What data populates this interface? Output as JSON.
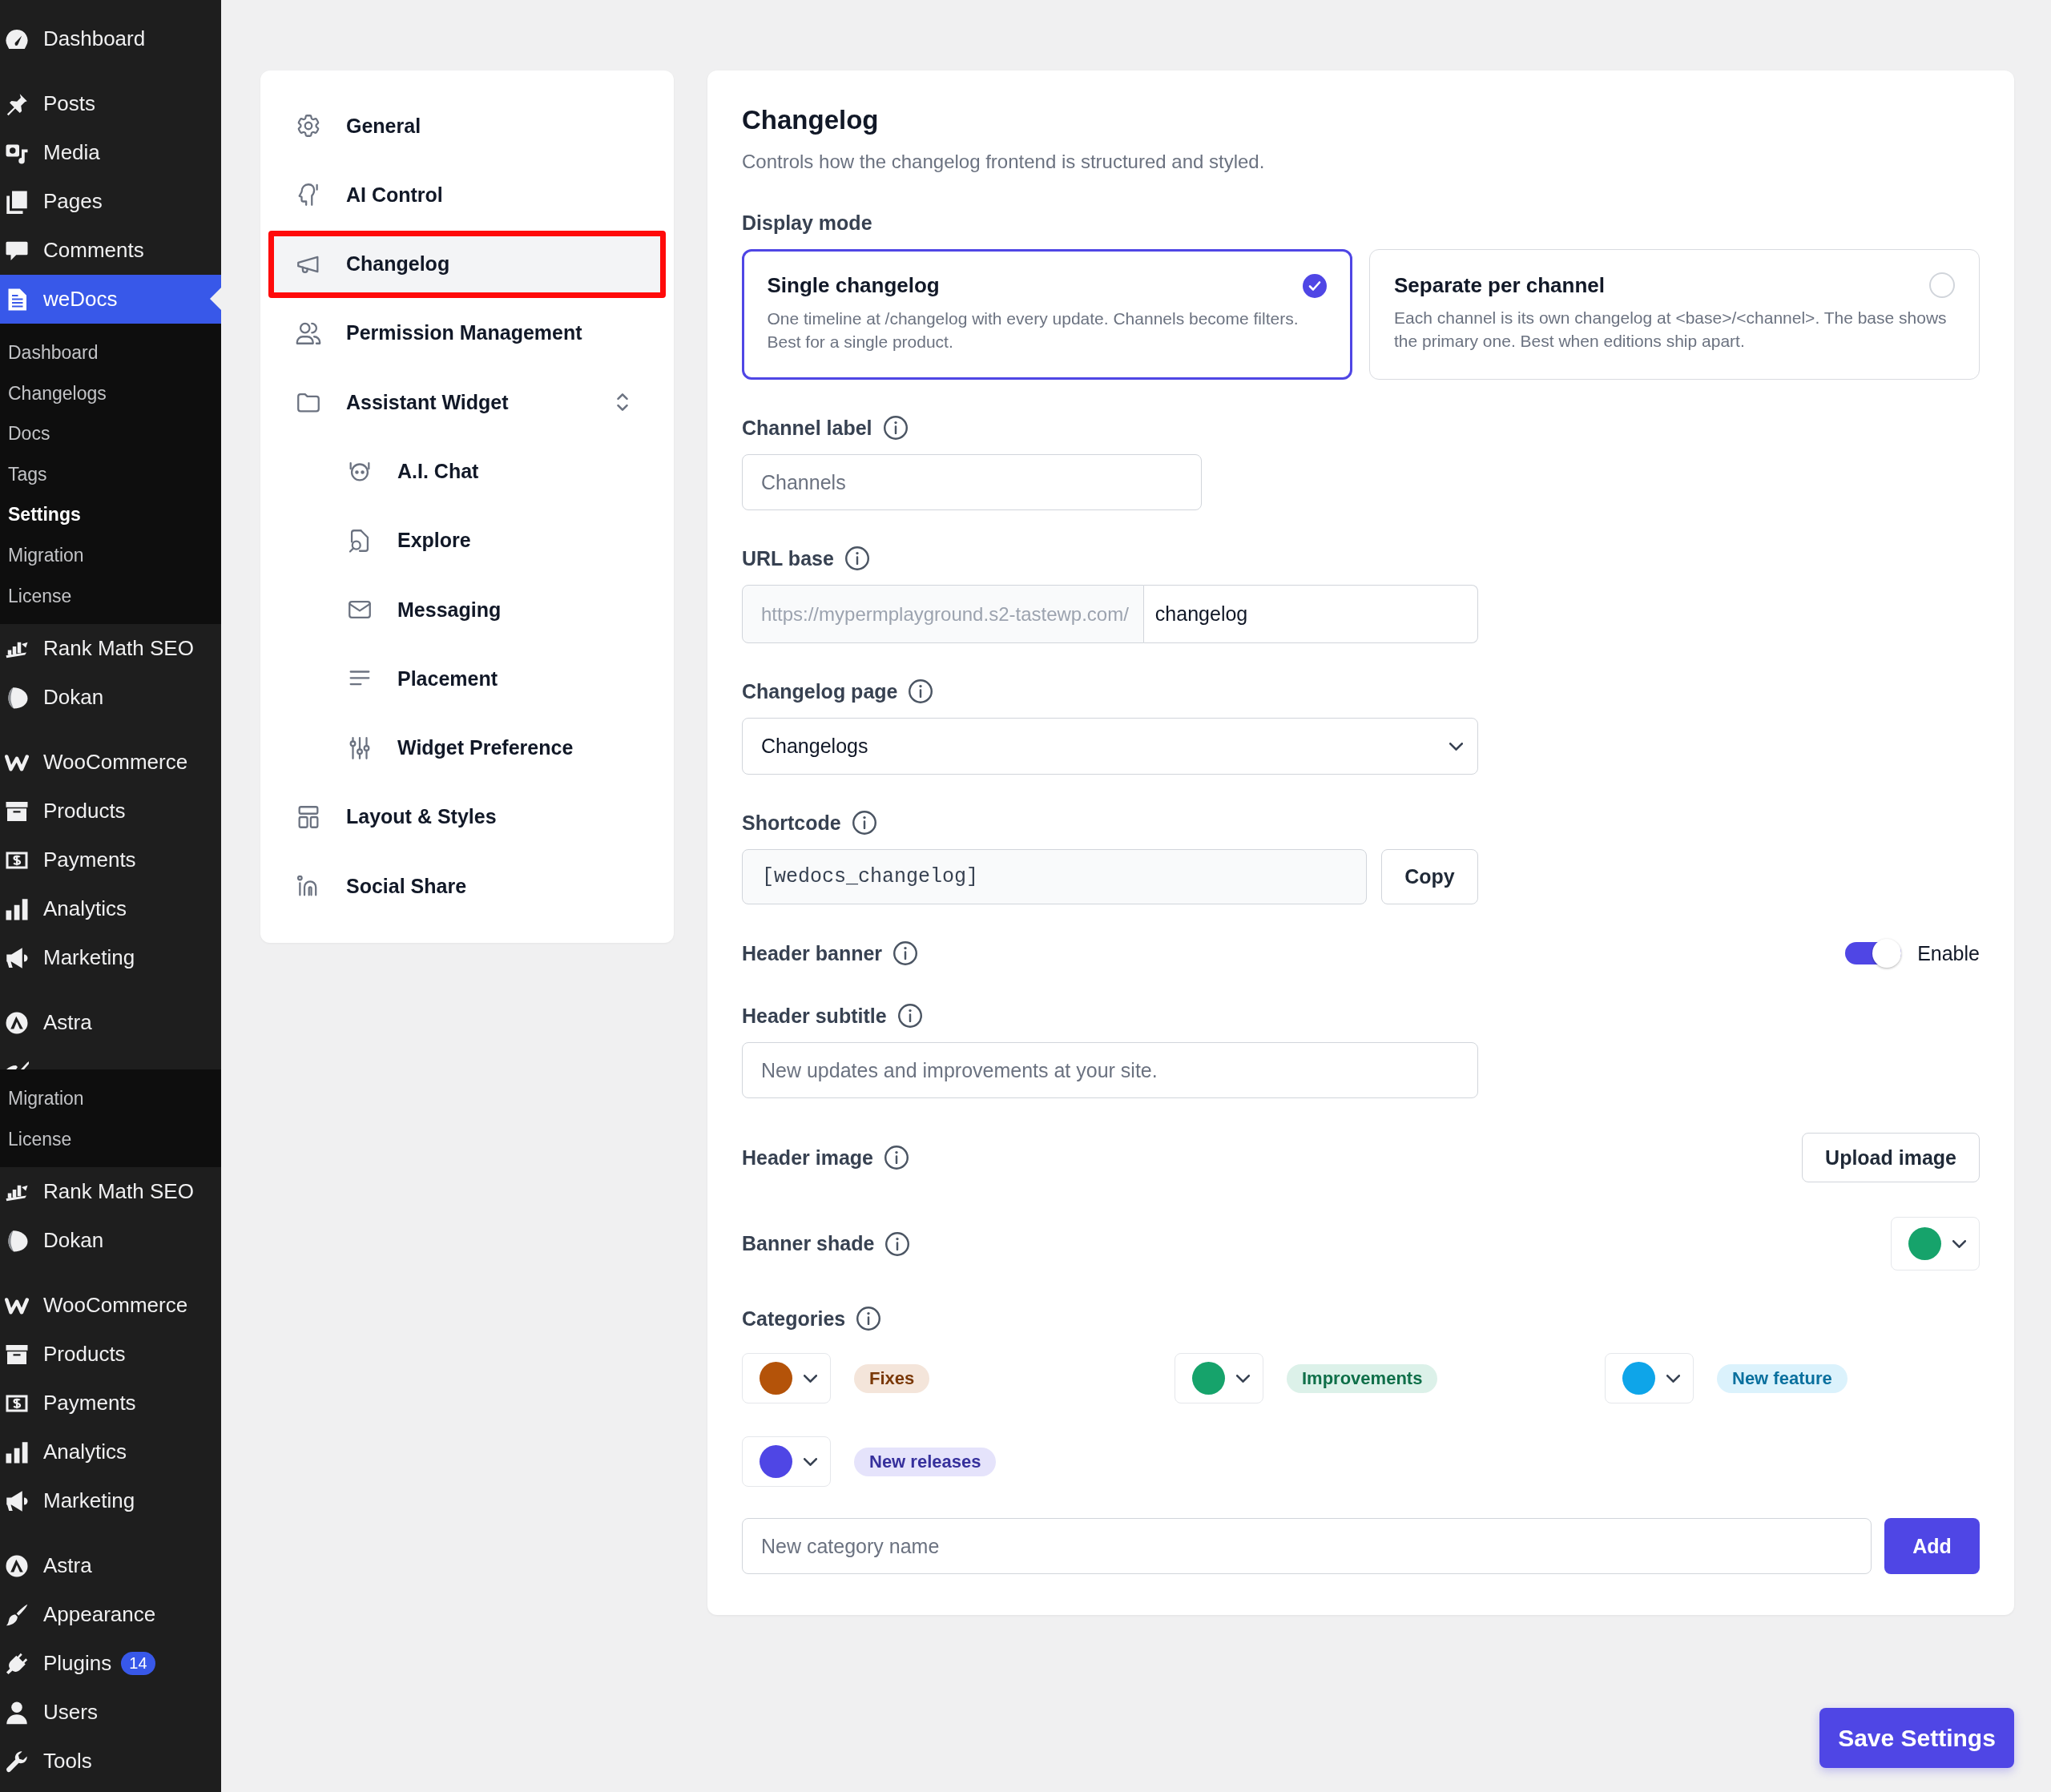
{
  "admin_menu": [
    {
      "kind": "group",
      "items": [
        {
          "label": "Dashboard",
          "selected": false
        }
      ]
    },
    {
      "kind": "group",
      "items": [
        {
          "label": "Posts",
          "selected": false
        },
        {
          "label": "Media",
          "selected": false
        },
        {
          "label": "Pages",
          "selected": false
        },
        {
          "label": "Comments",
          "selected": false
        },
        {
          "label": "weDocs",
          "selected": true,
          "submenu": [
            {
              "label": "Dashboard",
              "selected": false
            },
            {
              "label": "Changelogs",
              "selected": false
            },
            {
              "label": "Docs",
              "selected": false
            },
            {
              "label": "Tags",
              "selected": false
            },
            {
              "label": "Settings",
              "selected": true
            },
            {
              "label": "Migration",
              "selected": false
            },
            {
              "label": "License",
              "selected": false
            }
          ]
        }
      ]
    },
    {
      "kind": "group",
      "items": [
        {
          "label": "Rank Math SEO",
          "selected": false
        },
        {
          "label": "Dokan",
          "selected": false
        }
      ]
    },
    {
      "kind": "group",
      "items": [
        {
          "label": "WooCommerce",
          "selected": false
        },
        {
          "label": "Products",
          "selected": false
        },
        {
          "label": "Payments",
          "selected": false
        },
        {
          "label": "Analytics",
          "selected": false
        },
        {
          "label": "Marketing",
          "selected": false
        }
      ]
    },
    {
      "kind": "group",
      "items": [
        {
          "label": "Astra",
          "selected": false
        },
        {
          "kind": "clipped"
        }
      ]
    },
    {
      "kind": "submenu",
      "items": [
        {
          "label": "Migration",
          "selected": false
        },
        {
          "label": "License",
          "selected": false
        }
      ]
    },
    {
      "kind": "group",
      "items": [
        {
          "label": "Rank Math SEO",
          "selected": false
        },
        {
          "label": "Dokan",
          "selected": false
        }
      ]
    },
    {
      "kind": "group",
      "items": [
        {
          "label": "WooCommerce",
          "selected": false
        },
        {
          "label": "Products",
          "selected": false
        },
        {
          "label": "Payments",
          "selected": false
        },
        {
          "label": "Analytics",
          "selected": false
        },
        {
          "label": "Marketing",
          "selected": false
        }
      ]
    },
    {
      "kind": "group",
      "items": [
        {
          "label": "Astra",
          "selected": false
        },
        {
          "label": "Appearance",
          "selected": false
        },
        {
          "label": "Plugins",
          "selected": false,
          "badge": "14"
        },
        {
          "label": "Users",
          "selected": false
        },
        {
          "label": "Tools",
          "selected": false
        }
      ]
    }
  ],
  "settings_nav": [
    {
      "label": "General",
      "selected": false
    },
    {
      "label": "AI Control",
      "selected": false
    },
    {
      "label": "Changelog",
      "selected": true
    },
    {
      "label": "Permission Management",
      "selected": false
    },
    {
      "label": "Assistant Widget",
      "selected": false,
      "children": [
        {
          "label": "A.I. Chat",
          "selected": false
        },
        {
          "label": "Explore",
          "selected": false
        },
        {
          "label": "Messaging",
          "selected": false
        },
        {
          "label": "Placement",
          "selected": false
        },
        {
          "label": "Widget Preference",
          "selected": false
        }
      ]
    },
    {
      "label": "Layout & Styles",
      "selected": false
    },
    {
      "label": "Social Share",
      "selected": false
    }
  ],
  "panel": {
    "title": "Changelog",
    "description": "Controls how the changelog frontend is structured and styled.",
    "display_mode": {
      "label": "Display mode",
      "options": [
        {
          "title": "Single changelog",
          "description": "One timeline at /changelog with every update. Channels become filters. Best for a single product.",
          "selected": true
        },
        {
          "title": "Separate per channel",
          "description": "Each channel is its own changelog at <base>/<channel>. The base shows the primary one. Best when editions ship apart.",
          "selected": false
        }
      ]
    },
    "fields": [
      {
        "kind": "short",
        "label": "Channel label",
        "placeholder": "Channels"
      },
      {
        "kind": "url",
        "label": "URL base",
        "prefix": "https://mypermplayground.s2-tastewp.com/",
        "value": "changelog"
      },
      {
        "kind": "select",
        "label": "Changelog page",
        "value": "Changelogs"
      },
      {
        "kind": "shortcode",
        "label": "Shortcode",
        "value": "[wedocs_changelog]",
        "button": "Copy"
      },
      {
        "kind": "toggle",
        "label": "Header banner",
        "on": true,
        "toggle_label": "Enable"
      },
      {
        "kind": "text",
        "label": "Header subtitle",
        "placeholder": "New updates and improvements at your site."
      },
      {
        "kind": "upload",
        "label": "Header image",
        "button": "Upload image"
      },
      {
        "kind": "color",
        "label": "Banner shade",
        "color": "#16a36b"
      }
    ],
    "categories": {
      "label": "Categories",
      "items": [
        {
          "label": "Fixes",
          "color": "#b45309"
        },
        {
          "label": "Improvements",
          "color": "#16a36b"
        },
        {
          "label": "New feature",
          "color": "#0ea5e9"
        },
        {
          "label": "New releases",
          "color": "#4f46e5"
        }
      ],
      "new_placeholder": "New category name",
      "add_button": "Add"
    }
  },
  "save_button": "Save Settings"
}
